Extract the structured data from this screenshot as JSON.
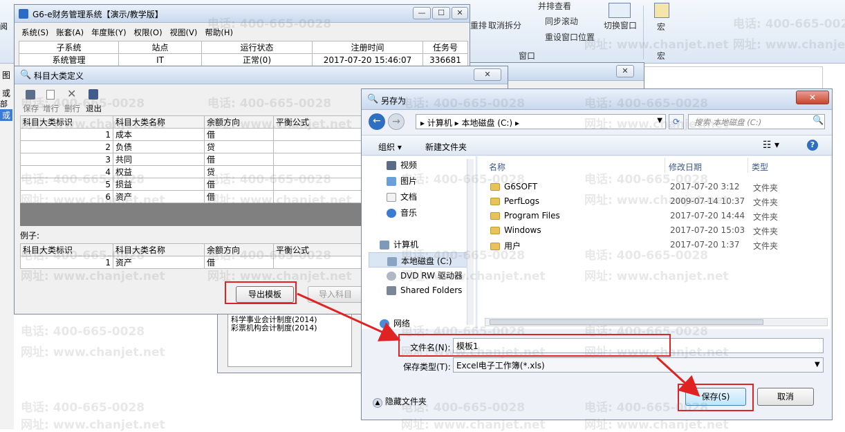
{
  "ribbon": {
    "items": [
      "并排查看",
      "同步滚动",
      "重设窗口位置",
      "取消拆分",
      "切换窗口",
      "宏",
      "窗口",
      "宏",
      "重排"
    ]
  },
  "left_strip": [
    "阅",
    "图",
    "或",
    "部容",
    "或"
  ],
  "main_window": {
    "title": "G6-e财务管理系统【演示/教学版】",
    "menu": [
      "系统(S)",
      "账套(A)",
      "年度账(Y)",
      "权限(O)",
      "视图(V)",
      "帮助(H)"
    ],
    "columns": [
      "子系统",
      "站点",
      "运行状态",
      "注册时间",
      "任务号"
    ],
    "row": [
      "系统管理",
      "IT",
      "正常(0)",
      "2017-07-20 15:46:07",
      "336681"
    ]
  },
  "category_window": {
    "title": "科目大类定义",
    "toolbar": [
      "保存",
      "增行",
      "删行",
      "退出"
    ],
    "columns": [
      "科目大类标识",
      "科目大类名称",
      "余额方向",
      "平衡公式"
    ],
    "rows": [
      {
        "id": "1",
        "name": "成本",
        "dir": "借"
      },
      {
        "id": "2",
        "name": "负债",
        "dir": "贷"
      },
      {
        "id": "3",
        "name": "共同",
        "dir": "借"
      },
      {
        "id": "4",
        "name": "权益",
        "dir": "贷"
      },
      {
        "id": "5",
        "name": "损益",
        "dir": "借"
      },
      {
        "id": "6",
        "name": "资产",
        "dir": "借"
      }
    ],
    "example_label": "例子:",
    "example_row": {
      "id": "1",
      "name": "资产",
      "dir": "借"
    },
    "export_btn": "导出模板",
    "import_btn": "导入科目"
  },
  "bg_window": {
    "lines": [
      "科学事业会计制度(2014)",
      "彩票机构会计制度(2014)"
    ]
  },
  "save_dialog": {
    "title": "另存为",
    "path": [
      "计算机",
      "本地磁盘 (C:)"
    ],
    "search_placeholder": "搜索 本地磁盘 (C:)",
    "toolbar": {
      "organize": "组织",
      "new_folder": "新建文件夹"
    },
    "nav": [
      "视频",
      "图片",
      "文档",
      "音乐",
      "计算机",
      "本地磁盘 (C:)",
      "DVD RW 驱动器",
      "Shared Folders",
      "网络"
    ],
    "columns": [
      "名称",
      "修改日期",
      "类型"
    ],
    "files": [
      {
        "name": "G6SOFT",
        "date": "2017-07-20 3:12",
        "type": "文件夹"
      },
      {
        "name": "PerfLogs",
        "date": "2009-07-14 10:37",
        "type": "文件夹"
      },
      {
        "name": "Program Files",
        "date": "2017-07-20 14:44",
        "type": "文件夹"
      },
      {
        "name": "Windows",
        "date": "2017-07-20 15:03",
        "type": "文件夹"
      },
      {
        "name": "用户",
        "date": "2017-07-20 1:37",
        "type": "文件夹"
      }
    ],
    "filename_label": "文件名(N):",
    "filename_value": "模板1",
    "filetype_label": "保存类型(T):",
    "filetype_value": "Excel电子工作簿(*.xls)",
    "hide_folders": "隐藏文件夹",
    "save_btn": "保存(S)",
    "cancel_btn": "取消"
  },
  "watermarks": {
    "phone": "电话: 400-665-0028",
    "site": "网址: www.chanjet.net"
  },
  "colors": {
    "highlight": "#e02222",
    "title_bar": "#c9d9ee",
    "selection": "#cce4f7"
  }
}
